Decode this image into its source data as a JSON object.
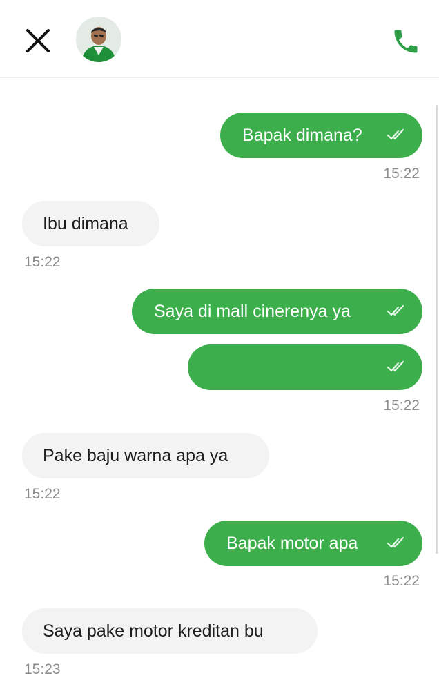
{
  "header": {
    "close_icon": "close-icon",
    "avatar_icon": "driver-avatar",
    "contact_name": "",
    "phone_icon": "phone-icon"
  },
  "colors": {
    "outgoing_bubble": "#3caf4c",
    "incoming_bubble": "#f3f3f3",
    "timestamp": "#8c8c8c",
    "accent": "#3caf4c"
  },
  "messages": [
    {
      "direction": "out",
      "text": "Bapak dimana?",
      "status": "double-check-icon"
    },
    {
      "direction": "out",
      "time": "15:22"
    },
    {
      "direction": "in",
      "text": "Ibu dimana",
      "time": "15:22"
    },
    {
      "direction": "out",
      "text": "Saya di mall cinerenya ya",
      "status": "double-check-icon"
    },
    {
      "direction": "out",
      "text": "",
      "status": "double-check-icon",
      "time": "15:22"
    },
    {
      "direction": "in",
      "text": "Pake baju warna apa ya",
      "time": "15:22"
    },
    {
      "direction": "out",
      "text": "Bapak motor apa",
      "status": "double-check-icon",
      "time": "15:22"
    },
    {
      "direction": "in",
      "text": "Saya pake motor kreditan bu",
      "time": "15:23"
    }
  ],
  "timestamps": [
    "15:22",
    "15:22",
    "15:22",
    "15:22",
    "15:22",
    "15:23"
  ]
}
